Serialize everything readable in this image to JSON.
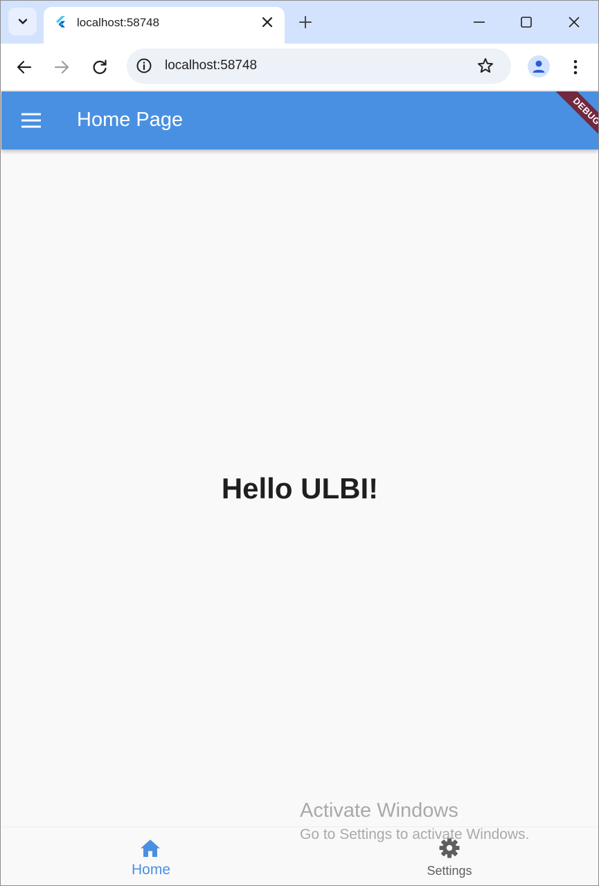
{
  "browser": {
    "tab": {
      "title": "localhost:58748"
    },
    "omnibox": {
      "url": "localhost:58748"
    }
  },
  "app": {
    "appbar": {
      "title": "Home Page"
    },
    "debug_banner": "DEBUG",
    "body": {
      "greeting": "Hello ULBI!"
    },
    "bottom_nav": {
      "items": [
        {
          "label": "Home",
          "icon": "home-icon",
          "selected": true
        },
        {
          "label": "Settings",
          "icon": "gear-icon",
          "selected": false
        }
      ]
    },
    "colors": {
      "primary": "#4a90e2",
      "background": "#f9f9f9",
      "debug": "#8b1a1a"
    }
  },
  "os_overlay": {
    "title": "Activate Windows",
    "subtitle": "Go to Settings to activate Windows."
  }
}
